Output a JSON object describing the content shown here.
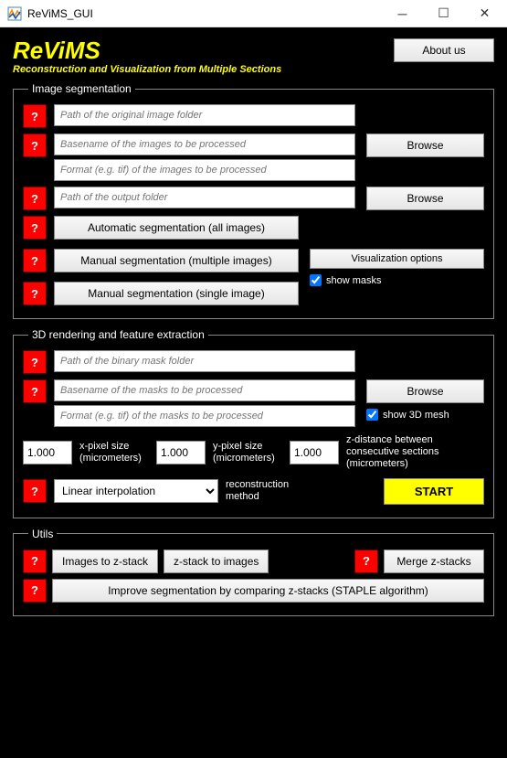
{
  "window": {
    "title": "ReViMS_GUI"
  },
  "header": {
    "title": "ReViMS",
    "subtitle": "Reconstruction and Visualization from Multiple Sections",
    "about": "About us"
  },
  "help": "?",
  "seg": {
    "legend": "Image segmentation",
    "path_original": "Path of the original image folder",
    "basename": "Basename of the images to be processed",
    "format": "Format (e.g. tif) of the images to be processed",
    "path_output": "Path of the output folder",
    "browse": "Browse",
    "auto": "Automatic segmentation (all images)",
    "manual_multi": "Manual segmentation (multiple images)",
    "manual_single": "Manual segmentation (single image)",
    "vis_options": "Visualization options",
    "show_masks": "show masks"
  },
  "render": {
    "legend": "3D rendering and feature extraction",
    "path_mask": "Path of the binary mask folder",
    "basename": "Basename of the masks to be processed",
    "format": "Format (e.g. tif) of the masks to be processed",
    "browse": "Browse",
    "show_3d": "show 3D mesh",
    "x_val": "1.000",
    "x_label": "x-pixel size (micrometers)",
    "y_val": "1.000",
    "y_label": "y-pixel size (micrometers)",
    "z_val": "1.000",
    "z_label": "z-distance between consecutive sections (micrometers)",
    "interp": "Linear interpolation",
    "recon_label": "reconstruction method",
    "start": "START"
  },
  "utils": {
    "legend": "Utils",
    "img_to_z": "Images to z-stack",
    "z_to_img": "z-stack to images",
    "merge": "Merge z-stacks",
    "improve": "Improve segmentation by comparing z-stacks (STAPLE algorithm)"
  }
}
